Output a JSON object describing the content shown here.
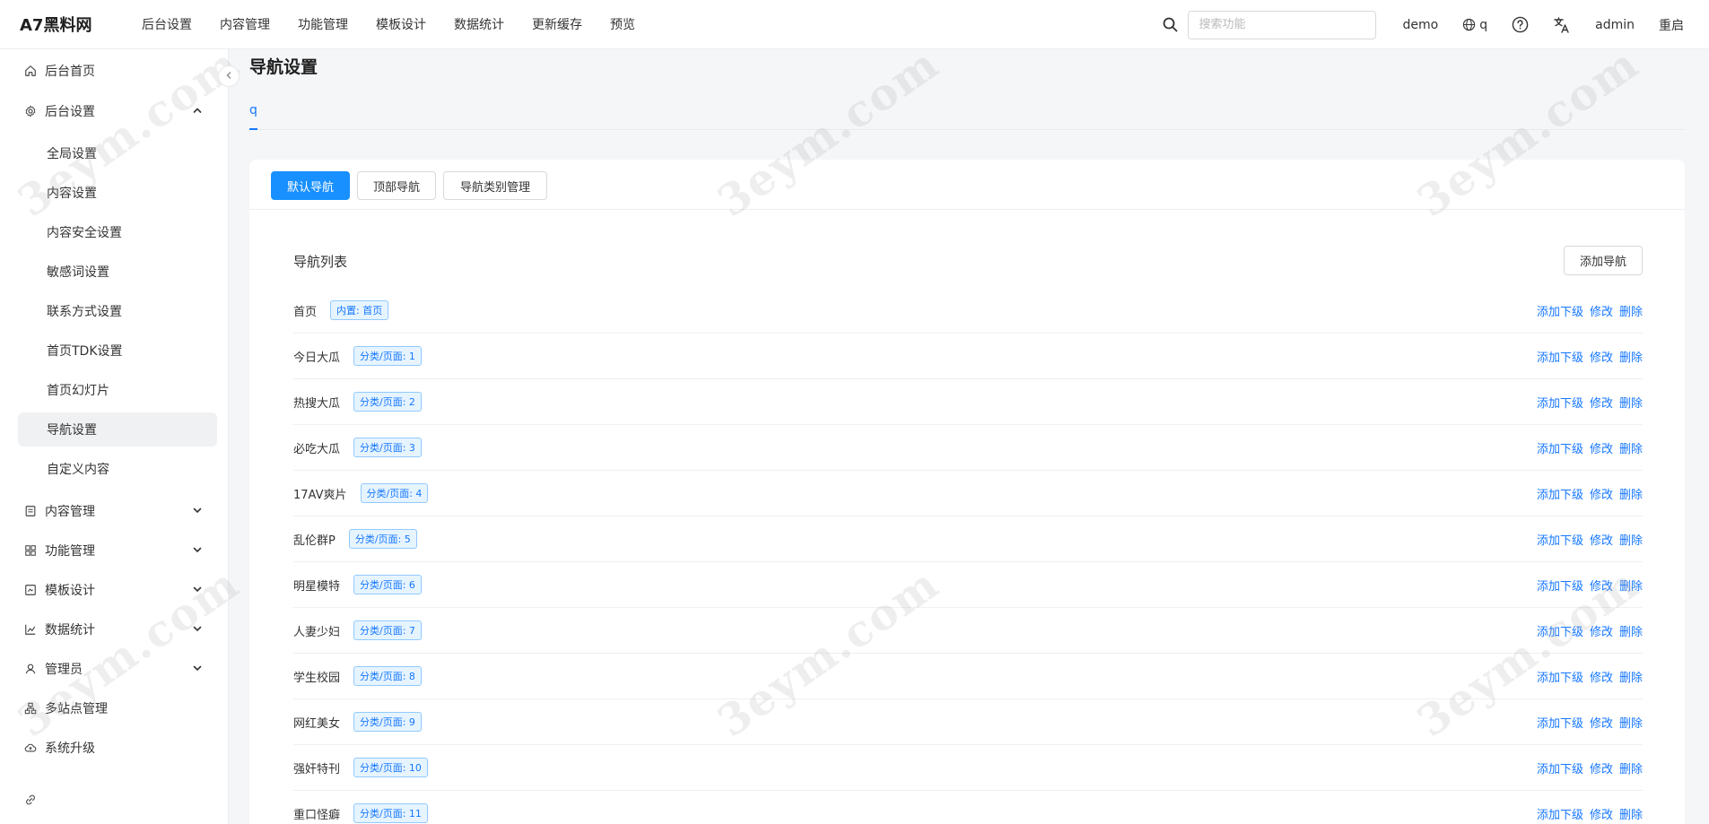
{
  "app": {
    "title": "A7黑料网"
  },
  "top_nav": [
    "后台设置",
    "内容管理",
    "功能管理",
    "模板设计",
    "数据统计",
    "更新缓存",
    "预览"
  ],
  "search": {
    "placeholder": "搜索功能",
    "value": ""
  },
  "top_right": {
    "user_site": "demo",
    "lang_site": "q",
    "account": "admin",
    "restart": "重启"
  },
  "sidebar": {
    "home": "后台首页",
    "settings": "后台设置",
    "sub_items": [
      "全局设置",
      "内容设置",
      "内容安全设置",
      "敏感词设置",
      "联系方式设置",
      "首页TDK设置",
      "首页幻灯片",
      "导航设置",
      "自定义内容"
    ],
    "active_sub": "导航设置",
    "groups": [
      "内容管理",
      "功能管理",
      "模板设计",
      "数据统计",
      "管理员"
    ],
    "multisite": "多站点管理",
    "upgrade": "系统升级"
  },
  "page": {
    "title": "导航设置",
    "tab": "q",
    "segments": [
      "默认导航",
      "顶部导航",
      "导航类别管理"
    ],
    "active_segment": "默认导航",
    "list_title": "导航列表",
    "add_button": "添加导航",
    "row_actions": [
      "添加下级",
      "修改",
      "删除"
    ],
    "rows": [
      {
        "name": "首页",
        "tag": "内置: 首页"
      },
      {
        "name": "今日大瓜",
        "tag": "分类/页面: 1"
      },
      {
        "name": "热搜大瓜",
        "tag": "分类/页面: 2"
      },
      {
        "name": "必吃大瓜",
        "tag": "分类/页面: 3"
      },
      {
        "name": "17AV爽片",
        "tag": "分类/页面: 4"
      },
      {
        "name": "乱伦群P",
        "tag": "分类/页面: 5"
      },
      {
        "name": "明星模特",
        "tag": "分类/页面: 6"
      },
      {
        "name": "人妻少妇",
        "tag": "分类/页面: 7"
      },
      {
        "name": "学生校园",
        "tag": "分类/页面: 8"
      },
      {
        "name": "网红美女",
        "tag": "分类/页面: 9"
      },
      {
        "name": "强奸特刊",
        "tag": "分类/页面: 10"
      },
      {
        "name": "重口怪癖",
        "tag": "分类/页面: 11"
      }
    ]
  },
  "icons": {
    "home": "home-icon",
    "settings": "gear-icon",
    "search": "search-icon",
    "globe": "globe-icon",
    "help": "help-icon",
    "translate": "translate-icon",
    "link": "link-icon"
  },
  "colors": {
    "primary": "#1890ff",
    "link": "#1677ff",
    "tag_bg": "#e6f4ff",
    "active_bg": "#f0f1f3"
  }
}
